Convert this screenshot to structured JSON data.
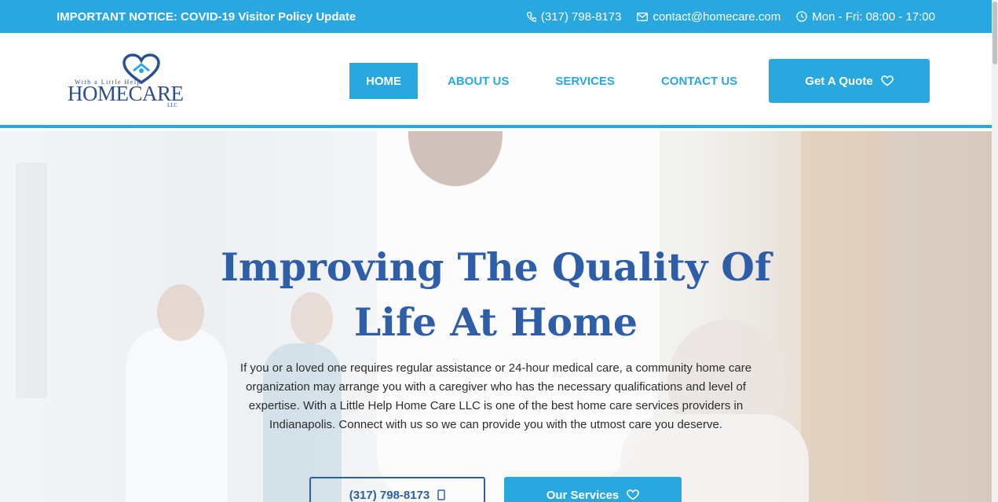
{
  "topbar": {
    "notice": "IMPORTANT NOTICE: COVID-19 Visitor Policy Update",
    "phone": "(317) 798-8173",
    "email": "contact@homecare.com",
    "hours": "Mon - Fri: 08:00 - 17:00"
  },
  "logo": {
    "tagline": "With a Little Help",
    "wordmark_home": "HOME",
    "wordmark_care": "CARE",
    "suffix": "LLC"
  },
  "nav": {
    "items": [
      {
        "label": "HOME",
        "active": true
      },
      {
        "label": "ABOUT US",
        "active": false
      },
      {
        "label": "SERVICES",
        "active": false
      },
      {
        "label": "CONTACT US",
        "active": false
      }
    ],
    "quote_label": "Get A Quote"
  },
  "hero": {
    "title_line1": "Improving The Quality Of",
    "title_line2": "Life At Home",
    "description": "If you or a loved one requires regular assistance or 24-hour medical care, a community home care organization may arrange you with a caregiver who has the necessary qualifications and level of expertise. With a Little Help Home Care LLC is one of the best home care services providers in Indianapolis. Connect with us so we can provide you with the utmost care you deserve.",
    "phone_button": "(317) 798-8173",
    "services_button": "Our Services"
  },
  "colors": {
    "accent": "#29a8e0",
    "brand_navy": "#2e5ea8",
    "text": "#2c2c2c"
  },
  "icons": [
    "phone-icon",
    "envelope-icon",
    "clock-icon",
    "heart-icon",
    "heart-house-logo-icon"
  ]
}
